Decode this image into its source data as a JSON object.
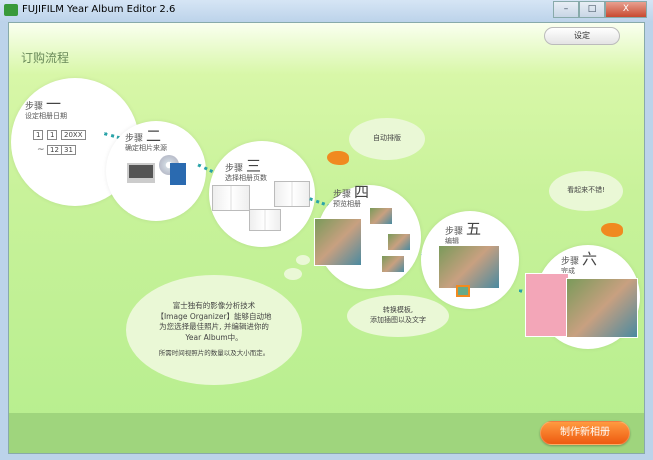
{
  "window": {
    "title": "FUJIFILM Year Album Editor 2.6",
    "buttons": [
      "–",
      "□",
      "X"
    ]
  },
  "header": {
    "title": "订购流程",
    "settings_label": "设定"
  },
  "steps": [
    {
      "label": "步骤",
      "num": "一",
      "desc": "设定相册日期",
      "dates": [
        "1",
        "1",
        "20XX",
        "~",
        "12",
        "31"
      ]
    },
    {
      "label": "步骤",
      "num": "二",
      "desc": "确定相片来源"
    },
    {
      "label": "步骤",
      "num": "三",
      "desc": "选择相册页数"
    },
    {
      "label": "步骤",
      "num": "四",
      "desc": "预览相册"
    },
    {
      "label": "步骤",
      "num": "五",
      "desc": "编辑"
    },
    {
      "label": "步骤",
      "num": "六",
      "desc": "完成"
    }
  ],
  "bubbles": {
    "auto_layout": "自动排版",
    "looks_good": "看起来不错!",
    "templates": "转换模板,\n添加插图以及文字",
    "info_line1": "富士独有的影像分析技术",
    "info_line2": "【Image Organizer】能够自动地",
    "info_line3": "为您选择最佳照片, 并编辑进你的",
    "info_line4": "Year Album中。",
    "info_note": "所需时间视照片的数量以及大小而定。"
  },
  "footer": {
    "create_label": "制作新相册"
  },
  "colors": {
    "accent": "#ee5a10",
    "background": "#c8f29a",
    "dots": "#2aa3a8"
  }
}
